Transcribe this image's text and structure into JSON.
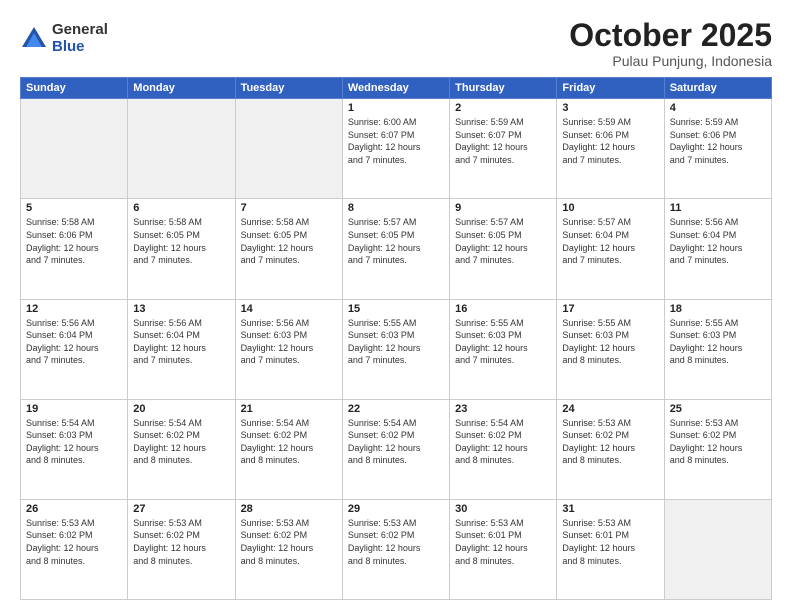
{
  "header": {
    "logo_general": "General",
    "logo_blue": "Blue",
    "month_title": "October 2025",
    "subtitle": "Pulau Punjung, Indonesia"
  },
  "weekdays": [
    "Sunday",
    "Monday",
    "Tuesday",
    "Wednesday",
    "Thursday",
    "Friday",
    "Saturday"
  ],
  "weeks": [
    [
      {
        "day": "",
        "text": ""
      },
      {
        "day": "",
        "text": ""
      },
      {
        "day": "",
        "text": ""
      },
      {
        "day": "1",
        "text": "Sunrise: 6:00 AM\nSunset: 6:07 PM\nDaylight: 12 hours\nand 7 minutes."
      },
      {
        "day": "2",
        "text": "Sunrise: 5:59 AM\nSunset: 6:07 PM\nDaylight: 12 hours\nand 7 minutes."
      },
      {
        "day": "3",
        "text": "Sunrise: 5:59 AM\nSunset: 6:06 PM\nDaylight: 12 hours\nand 7 minutes."
      },
      {
        "day": "4",
        "text": "Sunrise: 5:59 AM\nSunset: 6:06 PM\nDaylight: 12 hours\nand 7 minutes."
      }
    ],
    [
      {
        "day": "5",
        "text": "Sunrise: 5:58 AM\nSunset: 6:06 PM\nDaylight: 12 hours\nand 7 minutes."
      },
      {
        "day": "6",
        "text": "Sunrise: 5:58 AM\nSunset: 6:05 PM\nDaylight: 12 hours\nand 7 minutes."
      },
      {
        "day": "7",
        "text": "Sunrise: 5:58 AM\nSunset: 6:05 PM\nDaylight: 12 hours\nand 7 minutes."
      },
      {
        "day": "8",
        "text": "Sunrise: 5:57 AM\nSunset: 6:05 PM\nDaylight: 12 hours\nand 7 minutes."
      },
      {
        "day": "9",
        "text": "Sunrise: 5:57 AM\nSunset: 6:05 PM\nDaylight: 12 hours\nand 7 minutes."
      },
      {
        "day": "10",
        "text": "Sunrise: 5:57 AM\nSunset: 6:04 PM\nDaylight: 12 hours\nand 7 minutes."
      },
      {
        "day": "11",
        "text": "Sunrise: 5:56 AM\nSunset: 6:04 PM\nDaylight: 12 hours\nand 7 minutes."
      }
    ],
    [
      {
        "day": "12",
        "text": "Sunrise: 5:56 AM\nSunset: 6:04 PM\nDaylight: 12 hours\nand 7 minutes."
      },
      {
        "day": "13",
        "text": "Sunrise: 5:56 AM\nSunset: 6:04 PM\nDaylight: 12 hours\nand 7 minutes."
      },
      {
        "day": "14",
        "text": "Sunrise: 5:56 AM\nSunset: 6:03 PM\nDaylight: 12 hours\nand 7 minutes."
      },
      {
        "day": "15",
        "text": "Sunrise: 5:55 AM\nSunset: 6:03 PM\nDaylight: 12 hours\nand 7 minutes."
      },
      {
        "day": "16",
        "text": "Sunrise: 5:55 AM\nSunset: 6:03 PM\nDaylight: 12 hours\nand 7 minutes."
      },
      {
        "day": "17",
        "text": "Sunrise: 5:55 AM\nSunset: 6:03 PM\nDaylight: 12 hours\nand 8 minutes."
      },
      {
        "day": "18",
        "text": "Sunrise: 5:55 AM\nSunset: 6:03 PM\nDaylight: 12 hours\nand 8 minutes."
      }
    ],
    [
      {
        "day": "19",
        "text": "Sunrise: 5:54 AM\nSunset: 6:03 PM\nDaylight: 12 hours\nand 8 minutes."
      },
      {
        "day": "20",
        "text": "Sunrise: 5:54 AM\nSunset: 6:02 PM\nDaylight: 12 hours\nand 8 minutes."
      },
      {
        "day": "21",
        "text": "Sunrise: 5:54 AM\nSunset: 6:02 PM\nDaylight: 12 hours\nand 8 minutes."
      },
      {
        "day": "22",
        "text": "Sunrise: 5:54 AM\nSunset: 6:02 PM\nDaylight: 12 hours\nand 8 minutes."
      },
      {
        "day": "23",
        "text": "Sunrise: 5:54 AM\nSunset: 6:02 PM\nDaylight: 12 hours\nand 8 minutes."
      },
      {
        "day": "24",
        "text": "Sunrise: 5:53 AM\nSunset: 6:02 PM\nDaylight: 12 hours\nand 8 minutes."
      },
      {
        "day": "25",
        "text": "Sunrise: 5:53 AM\nSunset: 6:02 PM\nDaylight: 12 hours\nand 8 minutes."
      }
    ],
    [
      {
        "day": "26",
        "text": "Sunrise: 5:53 AM\nSunset: 6:02 PM\nDaylight: 12 hours\nand 8 minutes."
      },
      {
        "day": "27",
        "text": "Sunrise: 5:53 AM\nSunset: 6:02 PM\nDaylight: 12 hours\nand 8 minutes."
      },
      {
        "day": "28",
        "text": "Sunrise: 5:53 AM\nSunset: 6:02 PM\nDaylight: 12 hours\nand 8 minutes."
      },
      {
        "day": "29",
        "text": "Sunrise: 5:53 AM\nSunset: 6:02 PM\nDaylight: 12 hours\nand 8 minutes."
      },
      {
        "day": "30",
        "text": "Sunrise: 5:53 AM\nSunset: 6:01 PM\nDaylight: 12 hours\nand 8 minutes."
      },
      {
        "day": "31",
        "text": "Sunrise: 5:53 AM\nSunset: 6:01 PM\nDaylight: 12 hours\nand 8 minutes."
      },
      {
        "day": "",
        "text": ""
      }
    ]
  ]
}
